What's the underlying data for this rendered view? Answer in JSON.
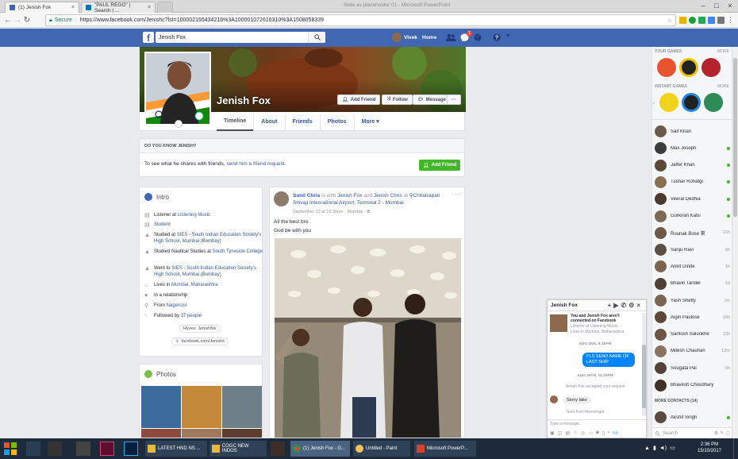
{
  "browser": {
    "tabs": [
      {
        "title": "(1) Jenish Fox"
      },
      {
        "title": "\"PAUL REGO\" | Search | ..."
      }
    ],
    "window_title": "Slide as placeholder 01 - Microsoft PowerPoint",
    "secure_label": "Secure",
    "url": "https://www.facebook.com/Jenishc?lst=100002155434216%3A100001072616310%3A1508058339"
  },
  "fb": {
    "search_value": "Jenish Fox",
    "user": "Vivek",
    "home": "Home",
    "notif_count": "1"
  },
  "profile": {
    "name": "Jenish Fox",
    "add_friend": "Add Friend",
    "follow": "Follow",
    "message": "Message",
    "more_dots": "···",
    "tabs": [
      "Timeline",
      "About",
      "Friends",
      "Photos",
      "More ▾"
    ],
    "know_title": "DO YOU KNOW JENISH?",
    "know_text": "To see what he shares with friends,",
    "know_link": "send him a friend request.",
    "know_btn": "Add Friend"
  },
  "intro": {
    "title": "Intro",
    "rows": [
      {
        "pre": "Listener at ",
        "link": "Listening Music"
      },
      {
        "pre": "",
        "link": "Student"
      },
      {
        "pre": "Studied at ",
        "link": "SIES - South Indian Education Society's High School, Mumbai (Bombay)"
      },
      {
        "pre": "Studied Nautical Studies at ",
        "link": "South Tyneside College"
      },
      {
        "pre": "Went to ",
        "link": "SIES - South Indian Education Society's High School, Mumbai (Bombay)"
      },
      {
        "pre": "Lives in ",
        "link": "Mumbai, Maharashtra"
      },
      {
        "pre": "In a relationship",
        "link": ""
      },
      {
        "pre": "From ",
        "link": "Nagercoil"
      },
      {
        "pre": "Followed by ",
        "link": "37 people"
      }
    ],
    "hyves": "Hyves: Jenishfox",
    "fb_url": "facebook.com/Jenishc"
  },
  "photos": {
    "title": "Photos"
  },
  "post": {
    "author": "Sunil Chris",
    "mid1": " is with ",
    "with1": "Jenish Fox",
    "mid2": " and ",
    "with2": "Jenish Chris",
    "mid3": " at ",
    "place": "Chhatrapati Shivaji International Airport, Terminal 2 - Mumbai",
    "meta": "September 10 at 10:30pm · Mumbai · ",
    "line1": "All the best bro",
    "line2": "God be with you",
    "menu": "···"
  },
  "right": {
    "your_games": "YOUR GAMES",
    "instant_games": "INSTANT GAMES",
    "more": "MORE",
    "contacts": [
      {
        "name": "Saif Khan",
        "status": "",
        "online": false
      },
      {
        "name": "Max Joseph",
        "status": "",
        "online": true
      },
      {
        "name": "Jaffer Khan",
        "status": "",
        "online": true
      },
      {
        "name": "Tushar Rohatgi",
        "status": "",
        "online": true
      },
      {
        "name": "Veeral Dedhia",
        "status": "",
        "online": true
      },
      {
        "name": "Gurkiran Kalsi",
        "status": "",
        "online": true
      },
      {
        "name": "Rounak Bose 來",
        "status": "21h",
        "online": false
      },
      {
        "name": "Sanju Ravi",
        "status": "6h",
        "online": false
      },
      {
        "name": "Ankit Dinde",
        "status": "1h",
        "online": false
      },
      {
        "name": "Bhavin Tandel",
        "status": "1d",
        "online": false
      },
      {
        "name": "Yash Shetty",
        "status": "1m",
        "online": false
      },
      {
        "name": "Aigin Paulose",
        "status": "16h",
        "online": false
      },
      {
        "name": "Santosh Salunkhe",
        "status": "13h",
        "online": false
      },
      {
        "name": "Mitesh Chauhan",
        "status": "12m",
        "online": false
      },
      {
        "name": "Sougata Pal",
        "status": "6h",
        "online": false
      },
      {
        "name": "Bhavesh Choudhary",
        "status": "",
        "online": false
      }
    ],
    "more_contacts": "MORE CONTACTS (14)",
    "extra_contact": {
      "name": "Akshit Singh",
      "online": true
    },
    "search": "Search"
  },
  "chat": {
    "title": "Jenish Fox",
    "notice": "You and Jenish Fox aren't connected on Facebook",
    "sub1": "Listener at Listening Music",
    "sub2": "Lives in Mumbai, Maharashtra",
    "date1": "AUG 2ND, 9:26PM",
    "msg_out": "PLS SEND NAME OF LAST SHIP",
    "date2": "AUG 26TH, 11:25PM",
    "accepted": "Jenish Fox accepted your request",
    "msg_in": "Stony lake",
    "sent_from": "Sent from Messenger",
    "input_placeholder": "Type a message..."
  },
  "taskbar": {
    "items": [
      "LATEST HND NS ...",
      "COGC NEW INDOS",
      "(1) Jenish Fox - G...",
      "Untitled - Paint",
      "Microsoft PowerP..."
    ],
    "time": "2:36 PM",
    "date": "15/10/2017"
  },
  "colors": {
    "fb_blue": "#4267b2",
    "link": "#365899",
    "green": "#42b72a",
    "messenger": "#0084ff"
  }
}
